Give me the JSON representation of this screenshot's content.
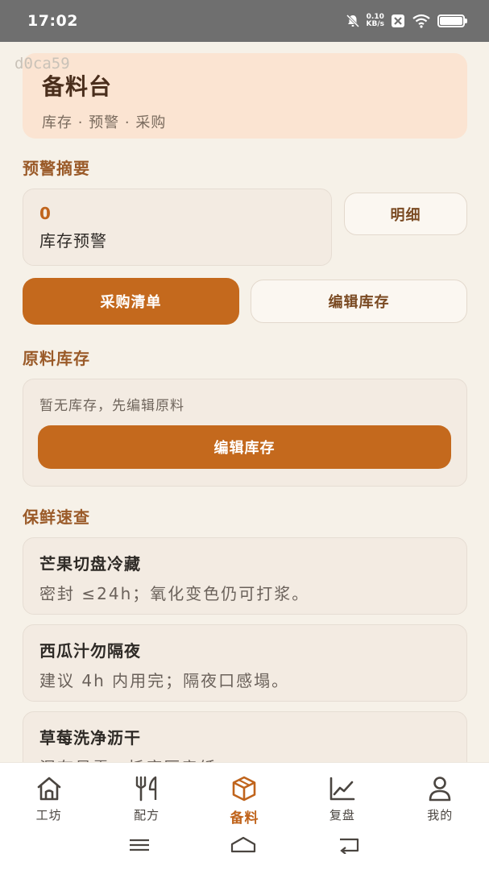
{
  "status_bar": {
    "time": "17:02",
    "net_speed_value": "0.10",
    "net_speed_unit": "KB/s",
    "icons": [
      "bell-muted-icon",
      "close-box-icon",
      "wifi-icon",
      "battery-icon"
    ]
  },
  "watermark": "d0ca59",
  "header": {
    "title": "备料台",
    "subtitle": "库存 · 预警 · 采购"
  },
  "alerts": {
    "section_title": "预警摘要",
    "count": "0",
    "label": "库存预警",
    "detail_button": "明细"
  },
  "actions": {
    "purchase_list": "采购清单",
    "edit_stock": "编辑库存"
  },
  "stock": {
    "section_title": "原料库存",
    "empty_text": "暂无库存，先编辑原料",
    "edit_button": "编辑库存"
  },
  "freshness": {
    "section_title": "保鲜速查",
    "items": [
      {
        "title": "芒果切盘冷藏",
        "desc": "密封 ≤24h；氧化变色仍可打浆。"
      },
      {
        "title": "西瓜汁勿隔夜",
        "desc": "建议 4h 内用完；隔夜口感塌。"
      },
      {
        "title": "草莓洗净沥干",
        "desc": "湿存易霉；托底厨房纸"
      }
    ]
  },
  "bottom_nav": {
    "items": [
      {
        "label": "工坊",
        "icon": "home-icon"
      },
      {
        "label": "配方",
        "icon": "utensils-icon"
      },
      {
        "label": "备料",
        "icon": "box-icon"
      },
      {
        "label": "复盘",
        "icon": "chart-icon"
      },
      {
        "label": "我的",
        "icon": "user-icon"
      }
    ],
    "active": "备料"
  },
  "colors": {
    "accent": "#c4691d",
    "section_title": "#9a5a28",
    "background": "#f6f1e8",
    "header_bg": "#fbe4d2"
  }
}
